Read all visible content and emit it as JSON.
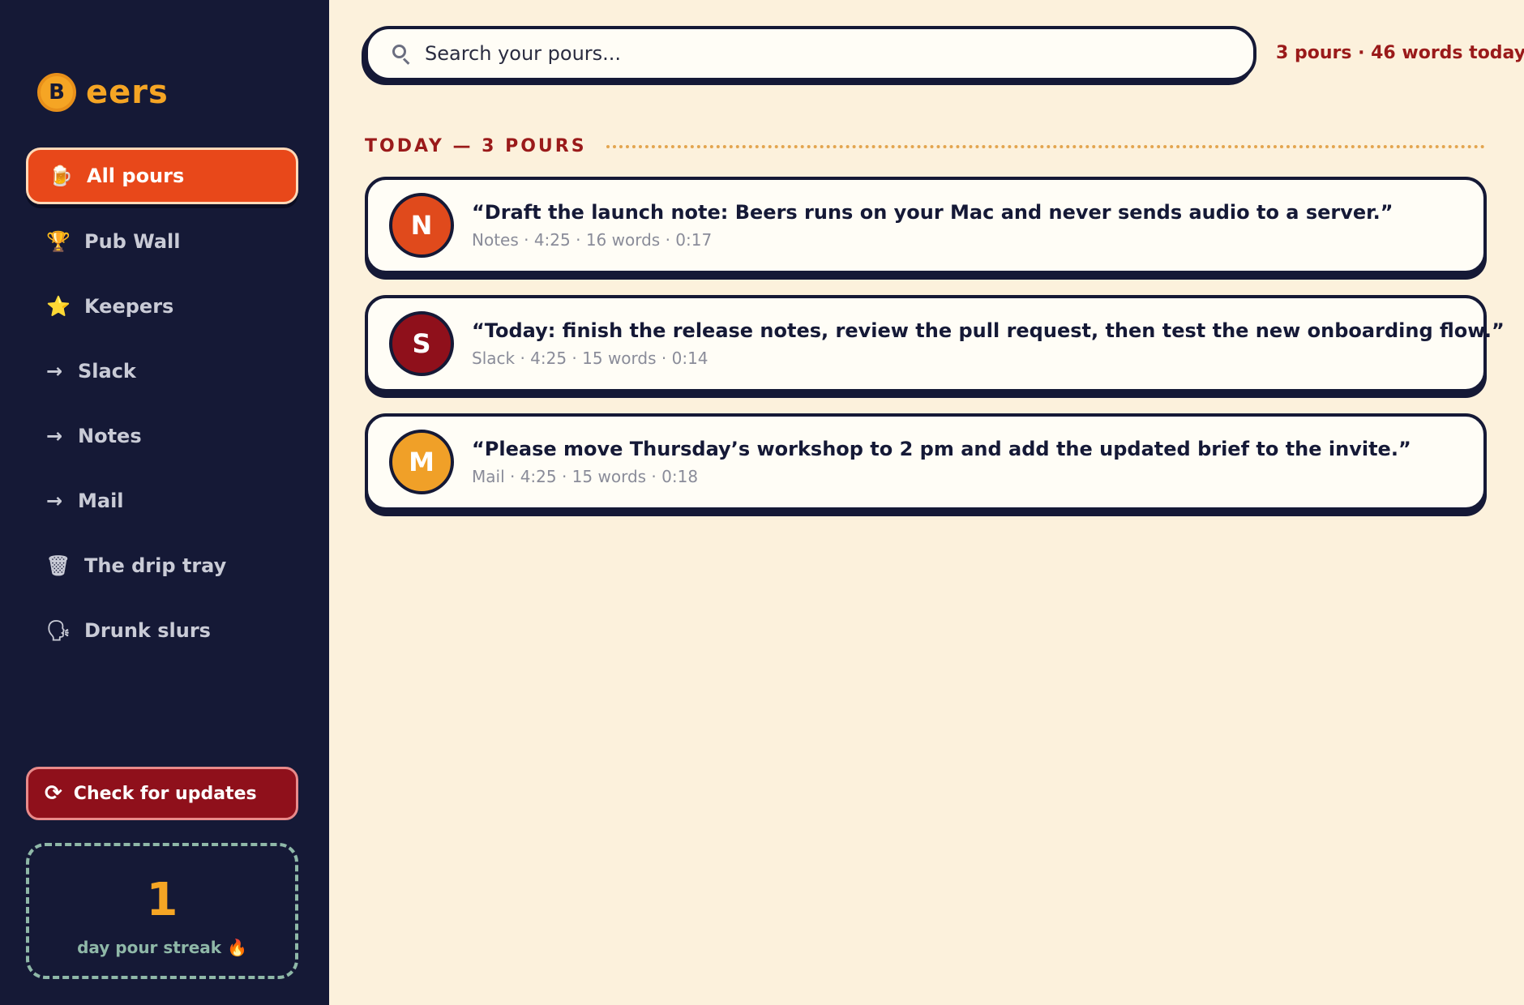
{
  "app": {
    "logo_letter": "B",
    "logo_text": "eers"
  },
  "colors": {
    "sidebar": "#151936",
    "background": "#fcf1dc",
    "accent": "#e8481a",
    "brand": "#f5a524",
    "danger": "#8f101b"
  },
  "sidebar": {
    "items": [
      {
        "label": "All pours",
        "icon": "beer-mug-icon",
        "active": true
      },
      {
        "label": "Pub Wall",
        "icon": "trophy-icon"
      },
      {
        "label": "Keepers",
        "icon": "star-icon"
      },
      {
        "label": "Slack",
        "icon": "arrow-right-icon"
      },
      {
        "label": "Notes",
        "icon": "arrow-right-icon"
      },
      {
        "label": "Mail",
        "icon": "arrow-right-icon"
      },
      {
        "label": "The drip tray",
        "icon": "trash-icon"
      },
      {
        "label": "Drunk slurs",
        "icon": "speaking-head-icon"
      }
    ],
    "update_button": "Check for updates",
    "streak": {
      "count": "1",
      "label": "day pour streak 🔥"
    }
  },
  "search": {
    "placeholder": "Search your pours..."
  },
  "stats": "3 pours · 46 words today",
  "section": {
    "title": "TODAY — 3 POURS"
  },
  "pours": [
    {
      "letter": "N",
      "color": "#e04a1c",
      "text": "“Draft the launch note: Beers runs on your Mac and never sends audio to a server.”",
      "meta": "Notes · 4:25 · 16 words · 0:17"
    },
    {
      "letter": "S",
      "color": "#8f101b",
      "text": "“Today: finish the release notes, review the pull request, then test the new onboarding flow.”",
      "meta": "Slack · 4:25 · 15 words · 0:14"
    },
    {
      "letter": "M",
      "color": "#f0a028",
      "text": "“Please move Thursday’s workshop to 2 pm and add the updated brief to the invite.”",
      "meta": "Mail · 4:25 · 15 words · 0:18"
    }
  ]
}
